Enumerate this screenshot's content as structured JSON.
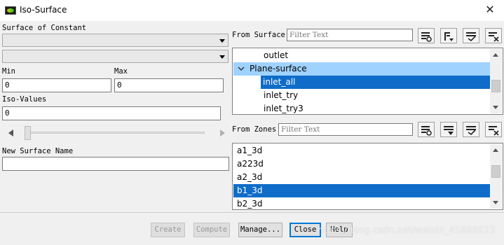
{
  "window": {
    "title": "Iso-Surface",
    "close_glyph": "✕"
  },
  "left": {
    "surface_of_constant_label": "Surface of Constant",
    "combo1_value": "",
    "combo2_value": "",
    "min_label": "Min",
    "max_label": "Max",
    "min_value": "0",
    "max_value": "0",
    "iso_values_label": "Iso-Values",
    "iso_values_value": "0",
    "slider_value": 0,
    "new_surface_name_label": "New Surface Name",
    "new_surface_name_value": ""
  },
  "from_surface": {
    "label": "From Surface",
    "filter_placeholder": "Filter Text",
    "items": [
      {
        "label": "outlet",
        "state": "normal"
      },
      {
        "label": "Plane-surface",
        "state": "group",
        "expanded": true
      },
      {
        "label": "inlet_all",
        "state": "selected"
      },
      {
        "label": "inlet_try",
        "state": "normal"
      },
      {
        "label": "inlet_try3",
        "state": "normal"
      }
    ],
    "toolbar_icons": [
      "select-all-icon",
      "sort-icon",
      "deselect-icon",
      "clear-icon"
    ]
  },
  "from_zones": {
    "label": "From Zones",
    "filter_placeholder": "Filter Text",
    "items": [
      {
        "label": "a1_3d",
        "state": "normal"
      },
      {
        "label": "a223d",
        "state": "normal"
      },
      {
        "label": "a2_3d",
        "state": "normal"
      },
      {
        "label": "b1_3d",
        "state": "selected"
      },
      {
        "label": "b2_3d",
        "state": "normal"
      }
    ],
    "toolbar_icons": [
      "select-all-icon",
      "sort-icon",
      "deselect-icon",
      "clear-icon"
    ]
  },
  "buttons": {
    "create": "Create",
    "compute": "Compute",
    "manage": "Manage...",
    "close": "Close",
    "help": "Help"
  },
  "watermark": "https://blog.csdn.net/weixin_45896923",
  "colors": {
    "selection": "#0f6cc8",
    "group_highlight": "#9fd2ff",
    "background": "#f0f0f0"
  }
}
